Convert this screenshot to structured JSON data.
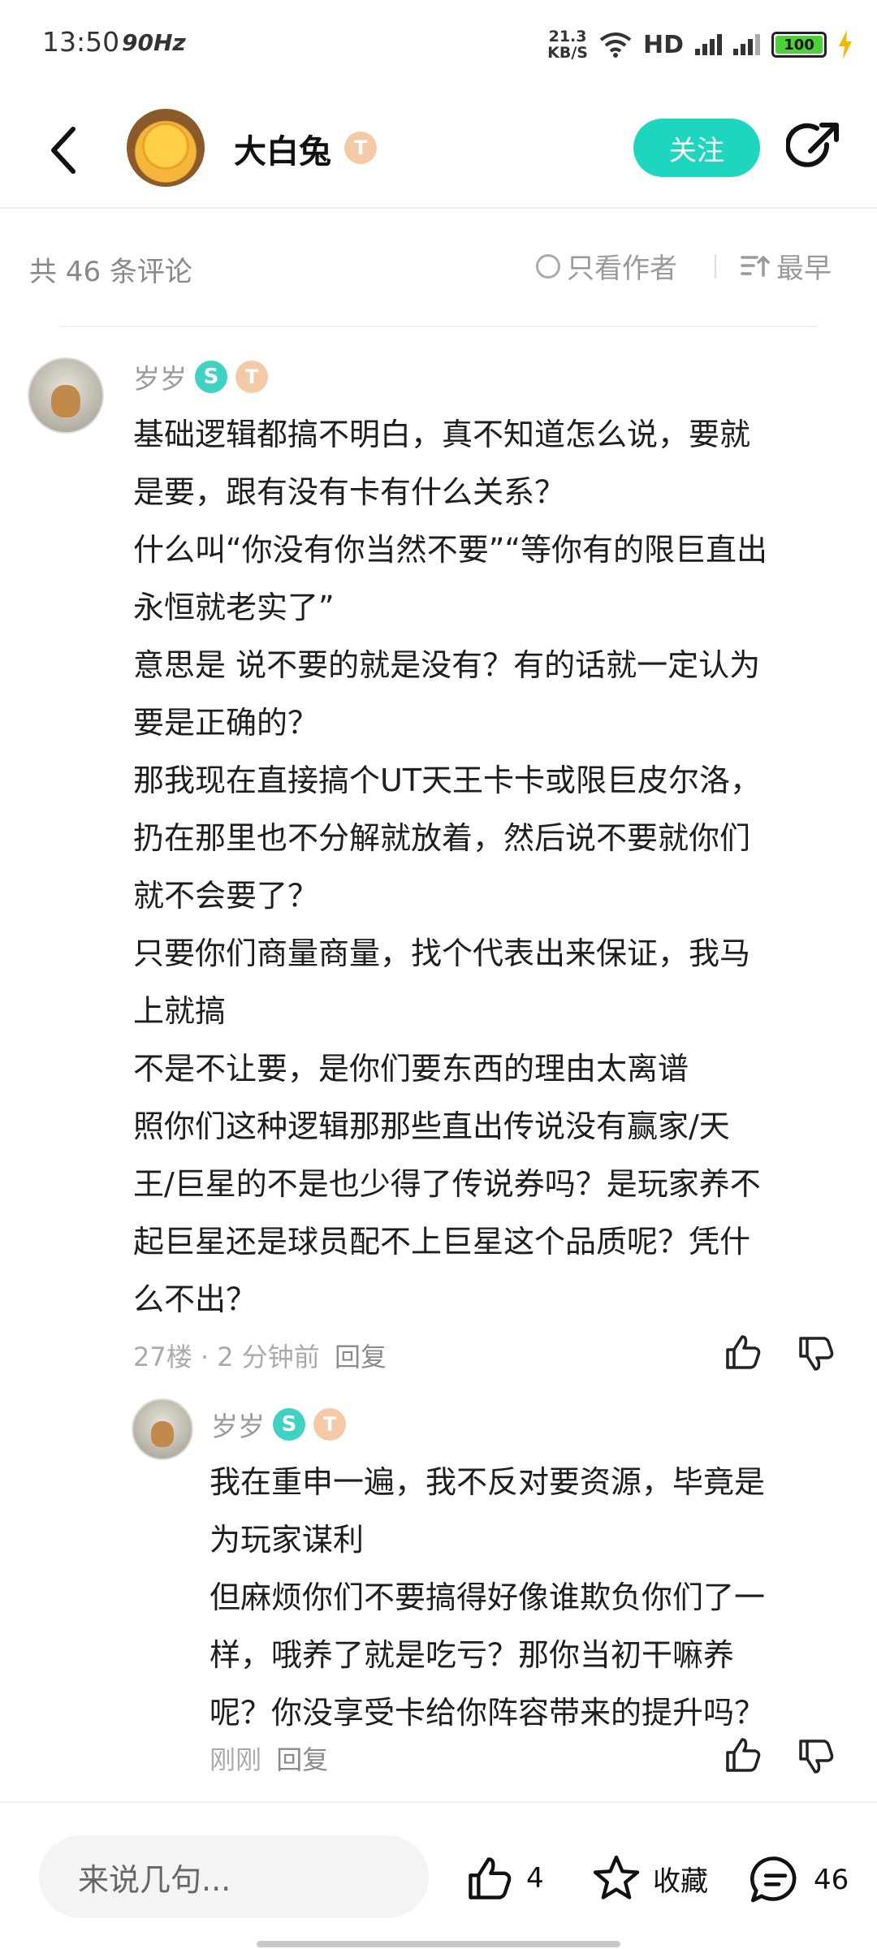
{
  "status_bar": {
    "time": "13:50",
    "refresh": "90Hz",
    "speed_value": "21.3",
    "speed_unit": "KB/S",
    "hd": "HD",
    "battery": "100",
    "icons": [
      "wifi-icon",
      "signal-icon",
      "battery-icon",
      "charging-icon"
    ]
  },
  "header": {
    "user_name": "大白兔",
    "level_badge": "T",
    "follow_label": "关注",
    "icons": [
      "back-icon",
      "share-icon"
    ]
  },
  "filter_bar": {
    "comment_count": "共 46 条评论",
    "only_author_label": "只看作者",
    "sort_label": "最早"
  },
  "comments": [
    {
      "user_name": "岁岁",
      "badge_s": "S",
      "badge_t": "T",
      "lines": [
        "基础逻辑都搞不明白，真不知道怎么说，要就",
        "是要，跟有没有卡有什么关系？",
        "什么叫“你没有你当然不要”“等你有的限巨直出",
        "永恒就老实了”",
        "意思是 说不要的就是没有？有的话就一定认为",
        "要是正确的？",
        "那我现在直接搞个UT天王卡卡或限巨皮尔洛，",
        "扔在那里也不分解就放着，然后说不要就你们",
        "就不会要了？",
        "只要你们商量商量，找个代表出来保证，我马",
        "上就搞",
        "不是不让要，是你们要东西的理由太离谱",
        "照你们这种逻辑那那些直出传说没有赢家/天",
        "王/巨星的不是也少得了传说券吗？是玩家养不",
        "起巨星还是球员配不上巨星这个品质呢？凭什",
        "么不出？"
      ],
      "meta": "27楼 · 2 分钟前",
      "reply_label": "回复"
    },
    {
      "user_name": "岁岁",
      "badge_s": "S",
      "badge_t": "T",
      "lines": [
        "我在重申一遍，我不反对要资源，毕竟是",
        "为玩家谋利",
        "但麻烦你们不要搞得好像谁欺负你们了一",
        "样，哦养了就是吃亏？那你当初干嘛养",
        "呢？你没享受卡给你阵容带来的提升吗？"
      ],
      "meta": "刚刚",
      "reply_label": "回复"
    }
  ],
  "bottom_bar": {
    "input_placeholder": "来说几句...",
    "like_count": "4",
    "favorite_label": "收藏",
    "comment_count": "46"
  }
}
